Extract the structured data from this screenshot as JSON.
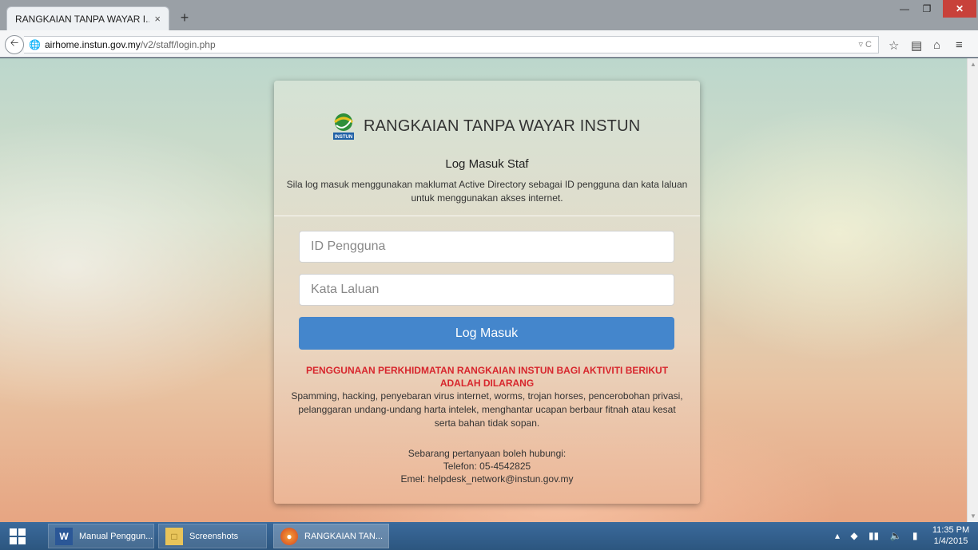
{
  "browser": {
    "tab_title": "RANGKAIAN TANPA WAYAR I...",
    "tab_close": "×",
    "new_tab": "+",
    "url_host": "airhome.instun.gov.my",
    "url_path": "/v2/staff/login.php"
  },
  "login": {
    "brand": "RANGKAIAN TANPA WAYAR INSTUN",
    "heading": "Log Masuk Staf",
    "intro": "Sila log masuk menggunakan maklumat Active Directory sebagai ID pengguna dan kata laluan untuk menggunakan akses internet.",
    "user_placeholder": "ID Pengguna",
    "password_placeholder": "Kata Laluan",
    "submit_label": "Log Masuk",
    "warning": "PENGGUNAAN PERKHIDMATAN RANGKAIAN INSTUN BAGI AKTIVITI BERIKUT ADALAH DILARANG",
    "rules": "Spamming, hacking, penyebaran virus internet, worms, trojan horses, pencerobohan privasi, pelanggaran undang-undang harta intelek, menghantar ucapan berbaur fitnah atau kesat serta bahan tidak sopan.",
    "contact_intro": "Sebarang pertanyaan boleh hubungi:",
    "phone": "Telefon: 05-4542825",
    "email": "Emel: helpdesk_network@instun.gov.my"
  },
  "taskbar": {
    "items": [
      {
        "label": "Manual Penggun...",
        "icon": "word-icon"
      },
      {
        "label": "Screenshots",
        "icon": "folder-icon"
      },
      {
        "label": "RANGKAIAN TAN...",
        "icon": "firefox-icon"
      }
    ],
    "time": "11:35 PM",
    "date": "1/4/2015"
  },
  "colors": {
    "button": "#4486cc",
    "warning": "#d7262d",
    "taskbar": "#2c567f"
  }
}
